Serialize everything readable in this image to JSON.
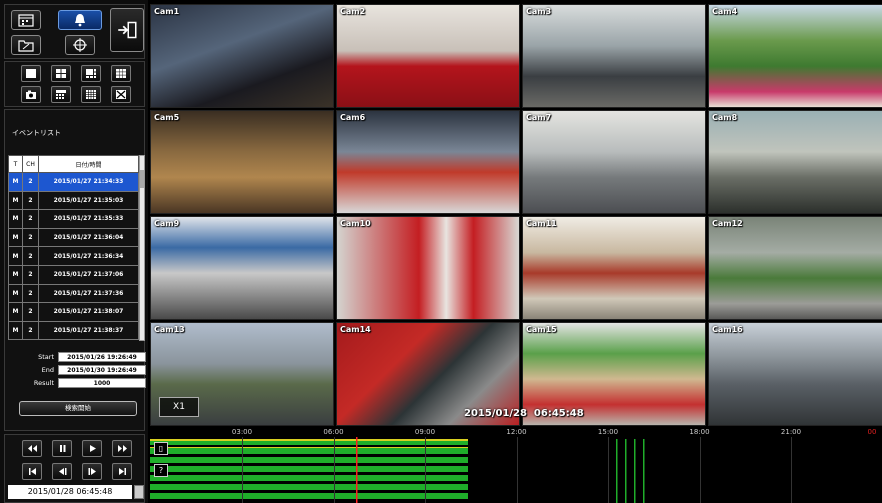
{
  "icons": {
    "schedule": "calendar-icon",
    "alarm": "bell-icon",
    "exit": "logout-icon",
    "folder": "folder-icon",
    "ptz": "crosshair-icon"
  },
  "event_list": {
    "title": "イベントリスト",
    "columns": [
      "T",
      "CH",
      "日付/時間"
    ],
    "rows": [
      {
        "t": "M",
        "ch": "2",
        "datetime": "2015/01/27 21:34:33"
      },
      {
        "t": "M",
        "ch": "2",
        "datetime": "2015/01/27 21:35:03"
      },
      {
        "t": "M",
        "ch": "2",
        "datetime": "2015/01/27 21:35:33"
      },
      {
        "t": "M",
        "ch": "2",
        "datetime": "2015/01/27 21:36:04"
      },
      {
        "t": "M",
        "ch": "2",
        "datetime": "2015/01/27 21:36:34"
      },
      {
        "t": "M",
        "ch": "2",
        "datetime": "2015/01/27 21:37:06"
      },
      {
        "t": "M",
        "ch": "2",
        "datetime": "2015/01/27 21:37:36"
      },
      {
        "t": "M",
        "ch": "2",
        "datetime": "2015/01/27 21:38:07"
      },
      {
        "t": "M",
        "ch": "2",
        "datetime": "2015/01/27 21:38:37"
      }
    ]
  },
  "search": {
    "start_label": "Start",
    "start_value": "2015/01/26 19:26:49",
    "end_label": "End",
    "end_value": "2015/01/30 19:26:49",
    "result_label": "Result",
    "result_value": "1000",
    "search_button": "検索開始"
  },
  "playback": {
    "datetime": "2015/01/28 06:45:48"
  },
  "cameras": [
    "Cam1",
    "Cam2",
    "Cam3",
    "Cam4",
    "Cam5",
    "Cam6",
    "Cam7",
    "Cam8",
    "Cam9",
    "Cam10",
    "Cam11",
    "Cam12",
    "Cam13",
    "Cam14",
    "Cam15",
    "Cam16"
  ],
  "overlay": {
    "zoom": "X1",
    "timestamp": "2015/01/28  06:45:48"
  },
  "timeline": {
    "labels": [
      "03:00",
      "06:00",
      "09:00",
      "12:00",
      "15:00",
      "18:00",
      "21:00"
    ],
    "end_label": "00",
    "help": "?",
    "colors": {
      "record": "#1fae2a",
      "cursor": "#ff2020",
      "warn": "#d8d020"
    }
  }
}
